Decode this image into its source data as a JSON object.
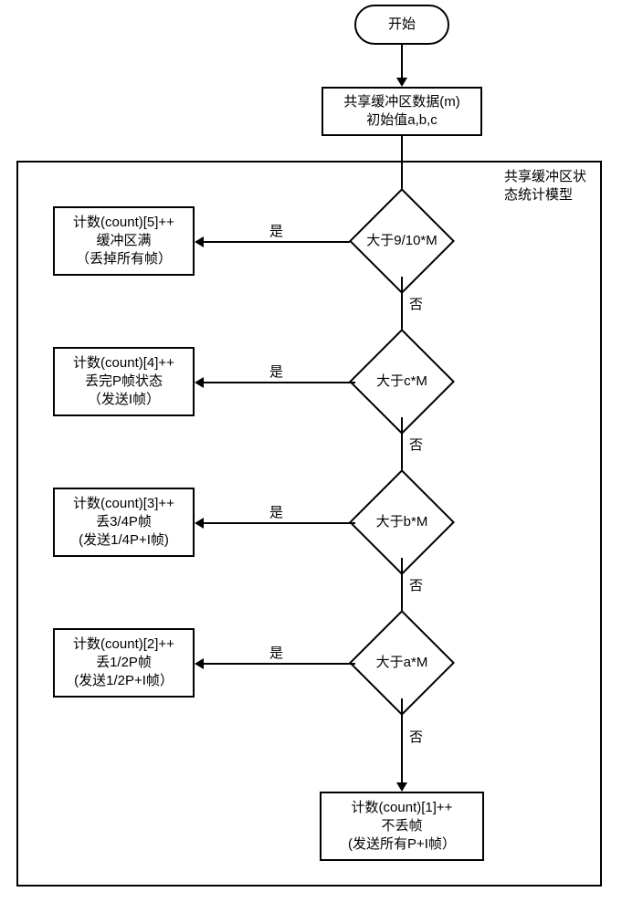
{
  "chart_data": {
    "type": "flowchart",
    "title": "",
    "nodes": [
      {
        "id": "start",
        "kind": "terminator",
        "label": "开始"
      },
      {
        "id": "init",
        "kind": "process",
        "label_lines": [
          "共享缓冲区数据(m)",
          "初始值a,b,c"
        ]
      },
      {
        "id": "d1",
        "kind": "decision",
        "label": "大于9/10*M"
      },
      {
        "id": "p1",
        "kind": "process",
        "label_lines": [
          "计数(count)[5]++",
          "缓冲区满",
          "（丢掉所有帧）"
        ]
      },
      {
        "id": "d2",
        "kind": "decision",
        "label": "大于c*M"
      },
      {
        "id": "p2",
        "kind": "process",
        "label_lines": [
          "计数(count)[4]++",
          "丢完P帧状态",
          "（发送I帧）"
        ]
      },
      {
        "id": "d3",
        "kind": "decision",
        "label": "大于b*M"
      },
      {
        "id": "p3",
        "kind": "process",
        "label_lines": [
          "计数(count)[3]++",
          "丢3/4P帧",
          "(发送1/4P+I帧)"
        ]
      },
      {
        "id": "d4",
        "kind": "decision",
        "label": "大于a*M"
      },
      {
        "id": "p4",
        "kind": "process",
        "label_lines": [
          "计数(count)[2]++",
          "丢1/2P帧",
          "(发送1/2P+I帧）"
        ]
      },
      {
        "id": "p5",
        "kind": "process",
        "label_lines": [
          "计数(count)[1]++",
          "不丢帧",
          "(发送所有P+I帧）"
        ]
      }
    ],
    "edges": [
      {
        "from": "start",
        "to": "init"
      },
      {
        "from": "init",
        "to": "d1"
      },
      {
        "from": "d1",
        "to": "p1",
        "label": "是"
      },
      {
        "from": "d1",
        "to": "d2",
        "label": "否"
      },
      {
        "from": "d2",
        "to": "p2",
        "label": "是"
      },
      {
        "from": "d2",
        "to": "d3",
        "label": "否"
      },
      {
        "from": "d3",
        "to": "p3",
        "label": "是"
      },
      {
        "from": "d3",
        "to": "d4",
        "label": "否"
      },
      {
        "from": "d4",
        "to": "p4",
        "label": "是"
      },
      {
        "from": "d4",
        "to": "p5",
        "label": "否"
      }
    ],
    "module_label": "共享缓冲区状态统计模型"
  },
  "labels": {
    "yes": "是",
    "no": "否"
  },
  "start_label": "开始",
  "init_l1": "共享缓冲区数据(m)",
  "init_l2": "初始值a,b,c",
  "d1_label": "大于9/10*M",
  "d2_label": "大于c*M",
  "d3_label": "大于b*M",
  "d4_label": "大于a*M",
  "p1_l1": "计数(count)[5]++",
  "p1_l2": "缓冲区满",
  "p1_l3": "（丢掉所有帧）",
  "p2_l1": "计数(count)[4]++",
  "p2_l2": "丢完P帧状态",
  "p2_l3": "（发送I帧）",
  "p3_l1": "计数(count)[3]++",
  "p3_l2": "丢3/4P帧",
  "p3_l3": "(发送1/4P+I帧)",
  "p4_l1": "计数(count)[2]++",
  "p4_l2": "丢1/2P帧",
  "p4_l3": "(发送1/2P+I帧）",
  "p5_l1": "计数(count)[1]++",
  "p5_l2": "不丢帧",
  "p5_l3": "(发送所有P+I帧）",
  "module_l1": "共享缓冲区状",
  "module_l2": "态统计模型"
}
